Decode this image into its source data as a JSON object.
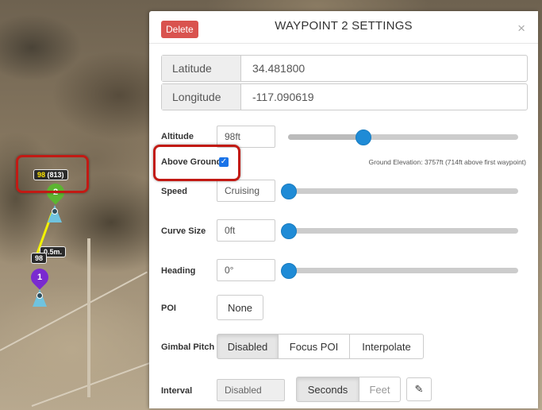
{
  "map": {
    "waypoint_1": {
      "number": "1",
      "label_alt": "98"
    },
    "waypoint_2": {
      "number": "2",
      "label_alt": "98",
      "label_ground": "(813)"
    },
    "distance_label": "0.5m."
  },
  "panel": {
    "delete_label": "Delete",
    "title": "WAYPOINT 2 SETTINGS",
    "close_glyph": "×",
    "latitude": {
      "label": "Latitude",
      "value": "34.481800"
    },
    "longitude": {
      "label": "Longitude",
      "value": "-117.090619"
    },
    "altitude": {
      "label": "Altitude",
      "value": "98ft",
      "slider_fraction": 0.32
    },
    "above_ground": {
      "label": "Above Ground",
      "checked": true,
      "check_glyph": "✓"
    },
    "ground_elevation": "Ground Elevation: 3757ft (714ft above first waypoint)",
    "speed": {
      "label": "Speed",
      "value": "Cruising",
      "slider_fraction": 0.0
    },
    "curve_size": {
      "label": "Curve Size",
      "value": "0ft",
      "slider_fraction": 0.0
    },
    "heading": {
      "label": "Heading",
      "value": "0°",
      "slider_fraction": 0.0
    },
    "poi": {
      "label": "POI",
      "button": "None"
    },
    "gimbal_pitch": {
      "label": "Gimbal Pitch",
      "options": [
        "Disabled",
        "Focus POI",
        "Interpolate"
      ],
      "selected": "Disabled"
    },
    "interval": {
      "label": "Interval",
      "value": "Disabled",
      "units": [
        "Seconds",
        "Feet"
      ],
      "selected_unit": "Seconds",
      "edit_icon": "✎"
    }
  },
  "colors": {
    "accent": "#1f8bd6",
    "delete": "#d9534f",
    "highlight_ring": "#c21a14",
    "track": "#f2f200"
  }
}
